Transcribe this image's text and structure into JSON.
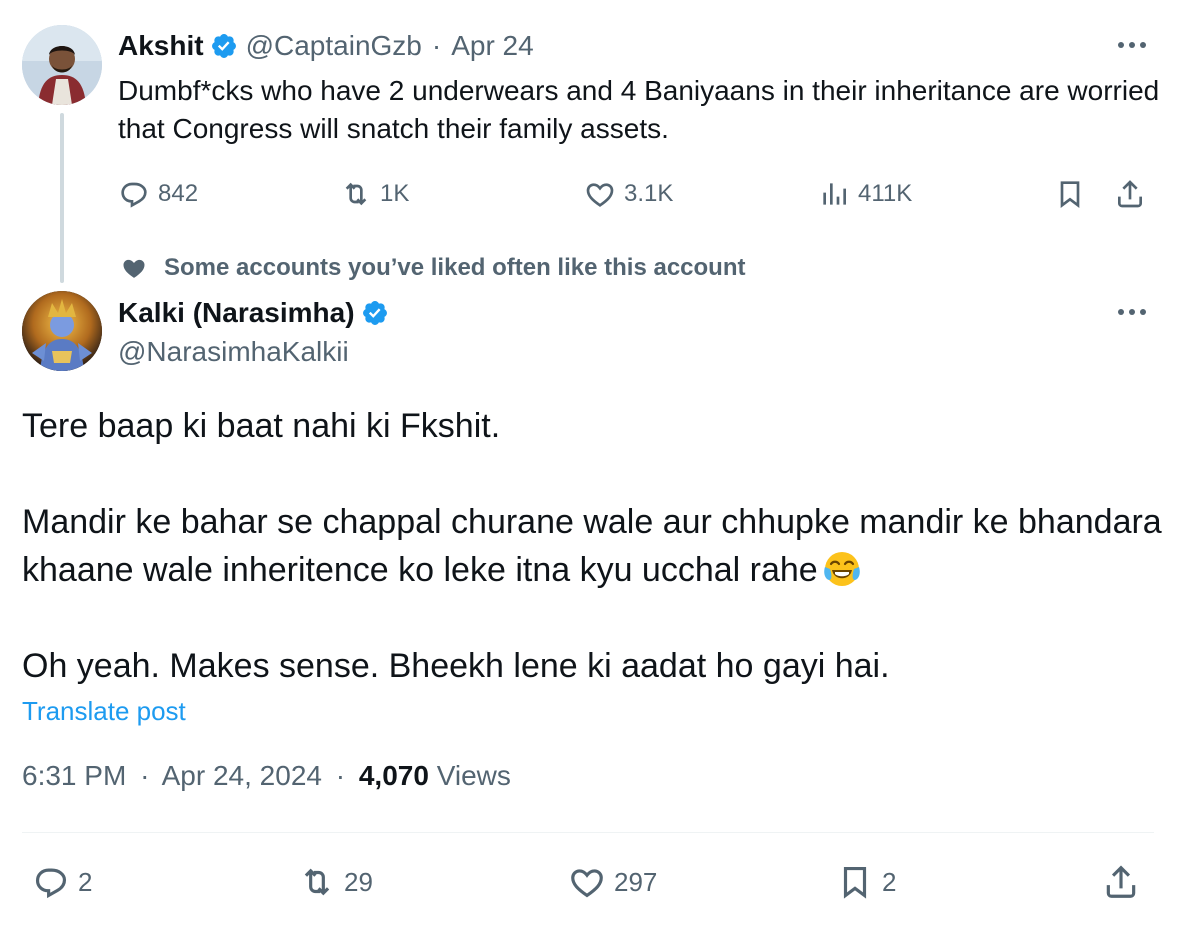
{
  "parent_tweet": {
    "author_name": "Akshit",
    "handle": "@CaptainGzb",
    "separator": "·",
    "date": "Apr 24",
    "text": "Dumbf*cks who have 2 underwears and 4 Baniyaans in their inheritance are worried that Congress will snatch their family assets.",
    "replies": "842",
    "reposts": "1K",
    "likes": "3.1K",
    "views": "411K"
  },
  "social_context": "Some accounts you’ve liked often like this account",
  "main_tweet": {
    "author_name": "Kalki (Narasimha)",
    "handle": "@NarasimhaKalkii",
    "paragraphs": [
      "Tere baap ki baat nahi ki Fkshit.",
      "Mandir ke bahar se chappal churane wale aur chhupke mandir ke bhandara khaane wale  inheritence ko leke itna kyu ucchal rahe",
      "Oh yeah. Makes sense. Bheekh lene ki aadat ho gayi hai."
    ],
    "translate_label": "Translate post",
    "time": "6:31 PM",
    "date": "Apr 24, 2024",
    "separator": "·",
    "views_count": "4,070",
    "views_label": "Views",
    "replies": "2",
    "reposts": "29",
    "likes": "297",
    "bookmarks": "2"
  },
  "icons": {
    "verified": "verified-badge-icon",
    "more": "more-options-icon",
    "reply": "reply-icon",
    "repost": "repost-icon",
    "like": "heart-icon",
    "views": "views-icon",
    "bookmark": "bookmark-icon",
    "share": "share-icon",
    "emoji": "face-with-tears-of-joy-emoji"
  },
  "colors": {
    "accent": "#1d9bf0",
    "text": "#0f1419",
    "muted": "#536471",
    "divider": "#eff3f4",
    "thread_line": "#cfd9de"
  }
}
